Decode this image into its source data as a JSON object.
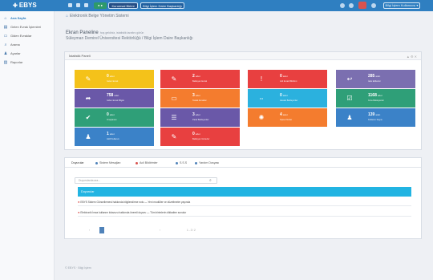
{
  "app": {
    "logo": "EBYS",
    "logo_icon": "plus-icon",
    "topbar_pills": [
      {
        "label": "● ●"
      },
      {
        "label": "Kurumsal Birimi"
      },
      {
        "label": "Bilgi İşlem Daire Başkanlığı"
      }
    ],
    "user_label": "Bilgi İşlem Kullanıcısı ▾"
  },
  "sidebar": {
    "items": [
      {
        "icon": "home-icon",
        "label": "Ana Sayfa",
        "active": true
      },
      {
        "icon": "document-icon",
        "label": "Gelen Evrak İşlemleri"
      },
      {
        "icon": "send-icon",
        "label": "Giden Evraklar"
      },
      {
        "icon": "search-icon",
        "label": "Arama"
      },
      {
        "icon": "user-icon",
        "label": "Ayarlar"
      },
      {
        "icon": "chart-icon",
        "label": "Raporlar"
      }
    ]
  },
  "breadcrumb": "Elektronik Belge Yönetim Sistemi",
  "page": {
    "title": "Ekran Paneline",
    "title_small": "hoş geldiniz, istatistik tarafını görün",
    "subtitle": "Süleyman Demirel Üniversitesi Rektörlüğü / Bilgi İşlem Daire Başkanlığı"
  },
  "stats_panel": {
    "title": "İstatistik Paneli",
    "tools": "▲ ⚙ ✕",
    "tiles": [
      {
        "value": "0",
        "unit": "adet",
        "sub": "Gelen Evrak",
        "color": "#f4c21a",
        "icon": "edit-icon"
      },
      {
        "value": "2",
        "unit": "adet",
        "sub": "Bekleyen Evrak",
        "color": "#e84040",
        "icon": "pencil-icon"
      },
      {
        "value": "0",
        "unit": "adet",
        "sub": "Acil Evrak Bildirimi",
        "color": "#e84040",
        "icon": "alert-icon"
      },
      {
        "value": "285",
        "unit": "adet",
        "sub": "İade Edilenler",
        "color": "#7b6fb0",
        "icon": "reply-icon"
      },
      {
        "value": "758",
        "unit": "adet",
        "sub": "Giden Evrak Bilgisi",
        "color": "#6a58a8",
        "icon": "share-icon"
      },
      {
        "value": "3",
        "unit": "adet",
        "sub": "Taslak Evraklar",
        "color": "#f47c2e",
        "icon": "comment-icon"
      },
      {
        "value": "0",
        "unit": "adet",
        "sub": "Havale Bekleyenler",
        "color": "#2bb1de",
        "icon": "dots-icon"
      },
      {
        "value": "1168",
        "unit": "adet",
        "sub": "İmza Bekleyenler",
        "color": "#2f9f78",
        "icon": "check-square-icon"
      },
      {
        "value": "0",
        "unit": "adet",
        "sub": "Onaylanan",
        "color": "#2f9f78",
        "icon": "check-circle-icon"
      },
      {
        "value": "3",
        "unit": "adet",
        "sub": "Paraf Bekleyenler",
        "color": "#6a58a8",
        "icon": "list-icon"
      },
      {
        "value": "4",
        "unit": "adet",
        "sub": "Kişisel Notlar",
        "color": "#f47c2e",
        "icon": "lightbulb-icon"
      },
      {
        "value": "139",
        "unit": "adet",
        "sub": "Kullanıcı Sayısı",
        "color": "#3b82c8",
        "icon": "user-icon"
      },
      {
        "value": "1",
        "unit": "adet",
        "sub": "Aktif Kullanıcı",
        "color": "#3b82c8",
        "icon": "user-icon"
      },
      {
        "value": "0",
        "unit": "adet",
        "sub": "Bekleyen Görevler",
        "color": "#e84040",
        "icon": "pencil-icon"
      }
    ]
  },
  "tabs": [
    {
      "label": "Duyurular",
      "active": true
    },
    {
      "label": "Sistem Mesajları",
      "dot": "#4f82b9"
    },
    {
      "label": "Acil Bildirimler",
      "dot": "#d9534f"
    },
    {
      "label": "S.S.S",
      "dot": "#4f82b9"
    },
    {
      "label": "Yardım Dosyası",
      "dot": "#4f82b9"
    }
  ],
  "search": {
    "placeholder": "Duyurularda ara..."
  },
  "list": {
    "header": "Duyurular",
    "items": [
      {
        "text": "EBYS Sistem Güncellemesi hakkında bilgilendirme notu — Yeni modüller ve düzeltmeler yayında"
      },
      {
        "text": "Elektronik İmza kullanım kılavuzu hakkında önemli duyuru — Tüm birimlerin dikkatine sunulur"
      }
    ]
  },
  "pager": {
    "prev": "‹",
    "next": "›",
    "info": "1 - 2 / 2"
  },
  "footer": "© EBYS · Bilgi İşlem"
}
